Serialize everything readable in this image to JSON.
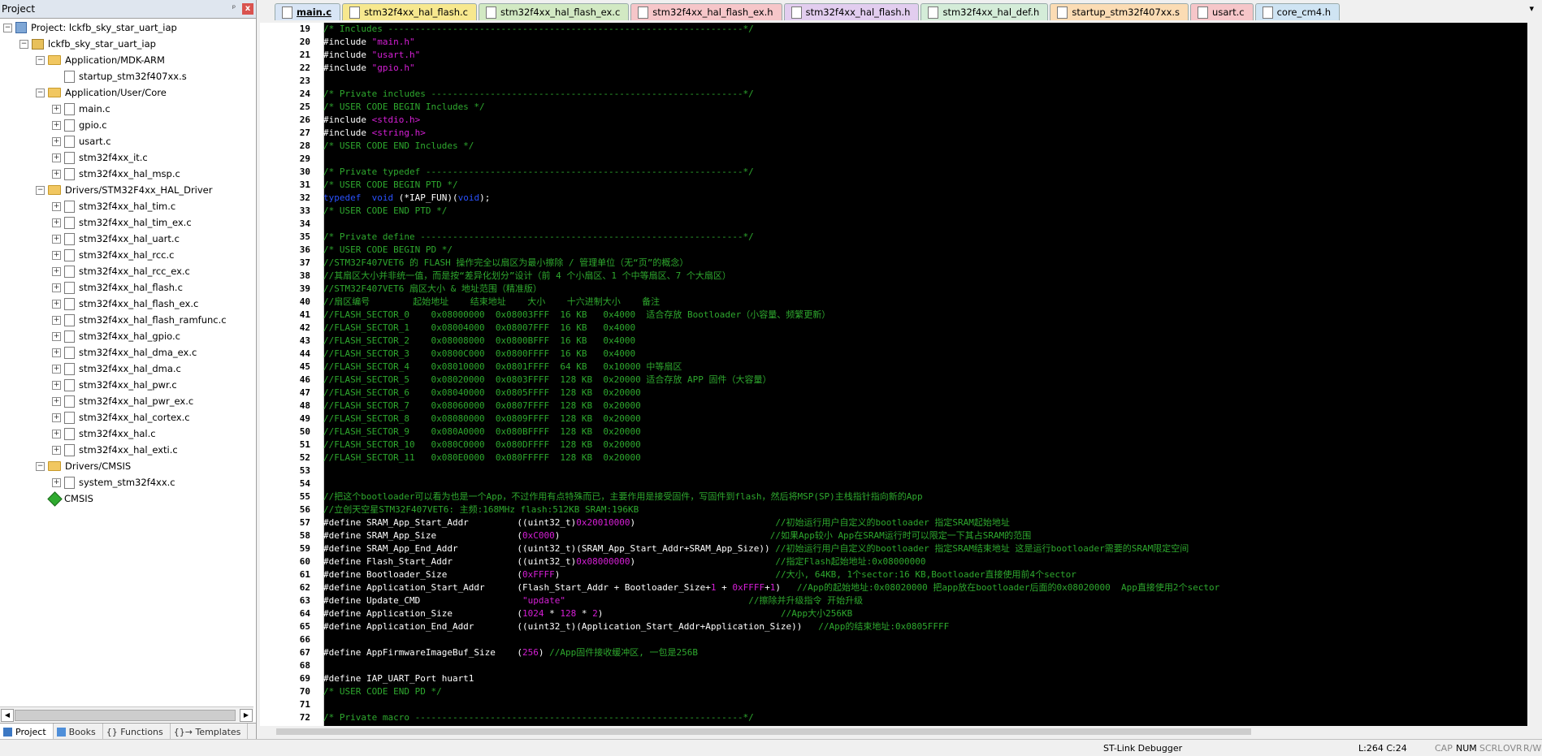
{
  "project_panel": {
    "title": "Project",
    "pin_label": "ᵖ",
    "close_label": "x",
    "tree": [
      {
        "label": "Project: lckfb_sky_star_uart_iap",
        "kind": "proj",
        "depth": 0,
        "exp": "−"
      },
      {
        "label": "lckfb_sky_star_uart_iap",
        "kind": "target",
        "depth": 1,
        "exp": "−"
      },
      {
        "label": "Application/MDK-ARM",
        "kind": "folder",
        "depth": 2,
        "exp": "−"
      },
      {
        "label": "startup_stm32f407xx.s",
        "kind": "file",
        "depth": 3,
        "exp": ""
      },
      {
        "label": "Application/User/Core",
        "kind": "folder",
        "depth": 2,
        "exp": "−"
      },
      {
        "label": "main.c",
        "kind": "file",
        "depth": 3,
        "exp": "+"
      },
      {
        "label": "gpio.c",
        "kind": "file",
        "depth": 3,
        "exp": "+"
      },
      {
        "label": "usart.c",
        "kind": "file",
        "depth": 3,
        "exp": "+"
      },
      {
        "label": "stm32f4xx_it.c",
        "kind": "file",
        "depth": 3,
        "exp": "+"
      },
      {
        "label": "stm32f4xx_hal_msp.c",
        "kind": "file",
        "depth": 3,
        "exp": "+"
      },
      {
        "label": "Drivers/STM32F4xx_HAL_Driver",
        "kind": "folder",
        "depth": 2,
        "exp": "−"
      },
      {
        "label": "stm32f4xx_hal_tim.c",
        "kind": "file",
        "depth": 3,
        "exp": "+"
      },
      {
        "label": "stm32f4xx_hal_tim_ex.c",
        "kind": "file",
        "depth": 3,
        "exp": "+"
      },
      {
        "label": "stm32f4xx_hal_uart.c",
        "kind": "file",
        "depth": 3,
        "exp": "+"
      },
      {
        "label": "stm32f4xx_hal_rcc.c",
        "kind": "file",
        "depth": 3,
        "exp": "+"
      },
      {
        "label": "stm32f4xx_hal_rcc_ex.c",
        "kind": "file",
        "depth": 3,
        "exp": "+"
      },
      {
        "label": "stm32f4xx_hal_flash.c",
        "kind": "file",
        "depth": 3,
        "exp": "+"
      },
      {
        "label": "stm32f4xx_hal_flash_ex.c",
        "kind": "file",
        "depth": 3,
        "exp": "+"
      },
      {
        "label": "stm32f4xx_hal_flash_ramfunc.c",
        "kind": "file",
        "depth": 3,
        "exp": "+"
      },
      {
        "label": "stm32f4xx_hal_gpio.c",
        "kind": "file",
        "depth": 3,
        "exp": "+"
      },
      {
        "label": "stm32f4xx_hal_dma_ex.c",
        "kind": "file",
        "depth": 3,
        "exp": "+"
      },
      {
        "label": "stm32f4xx_hal_dma.c",
        "kind": "file",
        "depth": 3,
        "exp": "+"
      },
      {
        "label": "stm32f4xx_hal_pwr.c",
        "kind": "file",
        "depth": 3,
        "exp": "+"
      },
      {
        "label": "stm32f4xx_hal_pwr_ex.c",
        "kind": "file",
        "depth": 3,
        "exp": "+"
      },
      {
        "label": "stm32f4xx_hal_cortex.c",
        "kind": "file",
        "depth": 3,
        "exp": "+"
      },
      {
        "label": "stm32f4xx_hal.c",
        "kind": "file",
        "depth": 3,
        "exp": "+"
      },
      {
        "label": "stm32f4xx_hal_exti.c",
        "kind": "file",
        "depth": 3,
        "exp": "+"
      },
      {
        "label": "Drivers/CMSIS",
        "kind": "folder",
        "depth": 2,
        "exp": "−"
      },
      {
        "label": "system_stm32f4xx.c",
        "kind": "file",
        "depth": 3,
        "exp": "+"
      },
      {
        "label": "CMSIS",
        "kind": "cmsis",
        "depth": 2,
        "exp": ""
      }
    ],
    "bottom_tabs": [
      {
        "label": "Project",
        "active": true,
        "color": "#3c78c3"
      },
      {
        "label": "Books",
        "active": false,
        "color": "#4f8fd9"
      },
      {
        "label": "{} Functions",
        "active": false,
        "color": ""
      },
      {
        "label": "{}→ Templates",
        "active": false,
        "color": ""
      }
    ]
  },
  "editor_tabs": [
    {
      "label": "main.c",
      "color": "#d8e5f5",
      "active": true
    },
    {
      "label": "stm32f4xx_hal_flash.c",
      "color": "#f7e88e",
      "active": false
    },
    {
      "label": "stm32f4xx_hal_flash_ex.c",
      "color": "#d2e9c3",
      "active": false
    },
    {
      "label": "stm32f4xx_hal_flash_ex.h",
      "color": "#f6c6c9",
      "active": false
    },
    {
      "label": "stm32f4xx_hal_flash.h",
      "color": "#e2cdef",
      "active": false
    },
    {
      "label": "stm32f4xx_hal_def.h",
      "color": "#d4ecd8",
      "active": false
    },
    {
      "label": "startup_stm32f407xx.s",
      "color": "#fbdcb4",
      "active": false
    },
    {
      "label": "usart.c",
      "color": "#f6c6c9",
      "active": false
    },
    {
      "label": "core_cm4.h",
      "color": "#cfe4f3",
      "active": false
    }
  ],
  "tab_dropdown": "▾",
  "colors": {
    "comment": "#2ea82e",
    "string": "#d61fd6",
    "keyword": "#2a52ff"
  },
  "code_lines": [
    {
      "n": "19",
      "segs": [
        [
          "c",
          "/* Includes ------------------------------------------------------------------*/"
        ]
      ]
    },
    {
      "n": "20",
      "segs": [
        [
          "p",
          "#include "
        ],
        [
          "s",
          "\"main.h\""
        ]
      ]
    },
    {
      "n": "21",
      "segs": [
        [
          "p",
          "#include "
        ],
        [
          "s",
          "\"usart.h\""
        ]
      ]
    },
    {
      "n": "22",
      "segs": [
        [
          "p",
          "#include "
        ],
        [
          "s",
          "\"gpio.h\""
        ]
      ]
    },
    {
      "n": "23",
      "segs": []
    },
    {
      "n": "24",
      "segs": [
        [
          "c",
          "/* Private includes ----------------------------------------------------------*/"
        ]
      ]
    },
    {
      "n": "25",
      "segs": [
        [
          "c",
          "/* USER CODE BEGIN Includes */"
        ]
      ]
    },
    {
      "n": "26",
      "segs": [
        [
          "p",
          "#include "
        ],
        [
          "s",
          "<stdio.h>"
        ]
      ]
    },
    {
      "n": "27",
      "segs": [
        [
          "p",
          "#include "
        ],
        [
          "s",
          "<string.h>"
        ]
      ]
    },
    {
      "n": "28",
      "segs": [
        [
          "c",
          "/* USER CODE END Includes */"
        ]
      ]
    },
    {
      "n": "29",
      "segs": []
    },
    {
      "n": "30",
      "segs": [
        [
          "c",
          "/* Private typedef -----------------------------------------------------------*/"
        ]
      ]
    },
    {
      "n": "31",
      "segs": [
        [
          "c",
          "/* USER CODE BEGIN PTD */"
        ]
      ]
    },
    {
      "n": "32",
      "segs": [
        [
          "k",
          "typedef  void "
        ],
        [
          "p",
          "(*IAP_FUN)("
        ],
        [
          "k",
          "void"
        ],
        [
          "p",
          ");"
        ]
      ]
    },
    {
      "n": "33",
      "segs": [
        [
          "c",
          "/* USER CODE END PTD */"
        ]
      ]
    },
    {
      "n": "34",
      "segs": []
    },
    {
      "n": "35",
      "segs": [
        [
          "c",
          "/* Private define ------------------------------------------------------------*/"
        ]
      ]
    },
    {
      "n": "36",
      "segs": [
        [
          "c",
          "/* USER CODE BEGIN PD */"
        ]
      ]
    },
    {
      "n": "37",
      "segs": [
        [
          "c",
          "//STM32F407VET6 的 FLASH 操作完全以扇区为最小擦除 / 管理单位（无“页”的概念）"
        ]
      ]
    },
    {
      "n": "38",
      "segs": [
        [
          "c",
          "//其扇区大小并非统一值，而是按“差异化划分”设计（前 4 个小扇区、1 个中等扇区、7 个大扇区）"
        ]
      ]
    },
    {
      "n": "39",
      "segs": [
        [
          "c",
          "//STM32F407VET6 扇区大小 & 地址范围（精准版）"
        ]
      ]
    },
    {
      "n": "40",
      "segs": [
        [
          "c",
          "//扇区编号        起始地址    结束地址    大小    十六进制大小    备注"
        ]
      ]
    },
    {
      "n": "41",
      "segs": [
        [
          "c",
          "//FLASH_SECTOR_0    0x08000000  0x08003FFF  16 KB   0x4000  适合存放 Bootloader（小容量、频繁更新）"
        ]
      ]
    },
    {
      "n": "42",
      "segs": [
        [
          "c",
          "//FLASH_SECTOR_1    0x08004000  0x08007FFF  16 KB   0x4000"
        ]
      ]
    },
    {
      "n": "43",
      "segs": [
        [
          "c",
          "//FLASH_SECTOR_2    0x08008000  0x0800BFFF  16 KB   0x4000"
        ]
      ]
    },
    {
      "n": "44",
      "segs": [
        [
          "c",
          "//FLASH_SECTOR_3    0x0800C000  0x0800FFFF  16 KB   0x4000"
        ]
      ]
    },
    {
      "n": "45",
      "segs": [
        [
          "c",
          "//FLASH_SECTOR_4    0x08010000  0x0801FFFF  64 KB   0x10000 中等扇区"
        ]
      ]
    },
    {
      "n": "46",
      "segs": [
        [
          "c",
          "//FLASH_SECTOR_5    0x08020000  0x0803FFFF  128 KB  0x20000 适合存放 APP 固件（大容量）"
        ]
      ]
    },
    {
      "n": "47",
      "segs": [
        [
          "c",
          "//FLASH_SECTOR_6    0x08040000  0x0805FFFF  128 KB  0x20000"
        ]
      ]
    },
    {
      "n": "48",
      "segs": [
        [
          "c",
          "//FLASH_SECTOR_7    0x08060000  0x0807FFFF  128 KB  0x20000"
        ]
      ]
    },
    {
      "n": "49",
      "segs": [
        [
          "c",
          "//FLASH_SECTOR_8    0x08080000  0x0809FFFF  128 KB  0x20000"
        ]
      ]
    },
    {
      "n": "50",
      "segs": [
        [
          "c",
          "//FLASH_SECTOR_9    0x080A0000  0x080BFFFF  128 KB  0x20000"
        ]
      ]
    },
    {
      "n": "51",
      "segs": [
        [
          "c",
          "//FLASH_SECTOR_10   0x080C0000  0x080DFFFF  128 KB  0x20000"
        ]
      ]
    },
    {
      "n": "52",
      "segs": [
        [
          "c",
          "//FLASH_SECTOR_11   0x080E0000  0x080FFFFF  128 KB  0x20000"
        ]
      ]
    },
    {
      "n": "53",
      "segs": []
    },
    {
      "n": "54",
      "segs": []
    },
    {
      "n": "55",
      "segs": [
        [
          "c",
          "//把这个bootloader可以看为也是一个App，不过作用有点特殊而已，主要作用是接受固件，写固件到flash，然后将MSP(SP)主栈指针指向新的App"
        ]
      ]
    },
    {
      "n": "56",
      "segs": [
        [
          "c",
          "//立创天空星STM32F407VET6: 主频:168MHz flash:512KB SRAM:196KB"
        ]
      ]
    },
    {
      "n": "57",
      "segs": [
        [
          "p",
          "#define SRAM_App_Start_Addr         ((uint32_t)"
        ],
        [
          "s",
          "0x20010000"
        ],
        [
          "p",
          ")                          "
        ],
        [
          "c",
          "//初始运行用户自定义的bootloader 指定SRAM起始地址"
        ]
      ]
    },
    {
      "n": "58",
      "segs": [
        [
          "p",
          "#define SRAM_App_Size               ("
        ],
        [
          "s",
          "0xC000"
        ],
        [
          "p",
          ")                                       "
        ],
        [
          "c",
          "//如果App较小 App在SRAM运行时可以限定一下其占SRAM的范围"
        ]
      ]
    },
    {
      "n": "59",
      "segs": [
        [
          "p",
          "#define SRAM_App_End_Addr           ((uint32_t)(SRAM_App_Start_Addr+SRAM_App_Size)) "
        ],
        [
          "c",
          "//初始运行用户自定义的bootloader 指定SRAM结束地址 这是运行bootloader需要的SRAM限定空间"
        ]
      ]
    },
    {
      "n": "60",
      "segs": [
        [
          "p",
          "#define Flash_Start_Addr            ((uint32_t)"
        ],
        [
          "s",
          "0x08000000"
        ],
        [
          "p",
          ")                          "
        ],
        [
          "c",
          "//指定Flash起始地址:0x08000000"
        ]
      ]
    },
    {
      "n": "61",
      "segs": [
        [
          "p",
          "#define Bootloader_Size             ("
        ],
        [
          "s",
          "0xFFFF"
        ],
        [
          "p",
          ")                                        "
        ],
        [
          "c",
          "//大小, 64KB, 1个sector:16 KB,Bootloader直接使用前4个sector"
        ]
      ]
    },
    {
      "n": "62",
      "segs": [
        [
          "p",
          "#define Application_Start_Addr      (Flash_Start_Addr + Bootloader_Size+"
        ],
        [
          "s",
          "1"
        ],
        [
          "p",
          " + "
        ],
        [
          "s",
          "0xFFFF"
        ],
        [
          "p",
          "+"
        ],
        [
          "s",
          "1"
        ],
        [
          "p",
          ")   "
        ],
        [
          "c",
          "//App的起始地址:0x08020000 把app放在bootloader后面的0x08020000  App直接使用2个sector"
        ]
      ]
    },
    {
      "n": "63",
      "segs": [
        [
          "p",
          "#define Update_CMD                   "
        ],
        [
          "s",
          "\"update\""
        ],
        [
          "p",
          "                                  "
        ],
        [
          "c",
          "//擦除并升级指令 开始升级"
        ]
      ]
    },
    {
      "n": "64",
      "segs": [
        [
          "p",
          "#define Application_Size            ("
        ],
        [
          "s",
          "1024"
        ],
        [
          "p",
          " * "
        ],
        [
          "s",
          "128"
        ],
        [
          "p",
          " * "
        ],
        [
          "s",
          "2"
        ],
        [
          "p",
          ")                                 "
        ],
        [
          "c",
          "//App大小256KB"
        ]
      ]
    },
    {
      "n": "65",
      "segs": [
        [
          "p",
          "#define Application_End_Addr        ((uint32_t)(Application_Start_Addr+Application_Size))   "
        ],
        [
          "c",
          "//App的结束地址:0x0805FFFF"
        ]
      ]
    },
    {
      "n": "66",
      "segs": []
    },
    {
      "n": "67",
      "segs": [
        [
          "p",
          "#define AppFirmwareImageBuf_Size    ("
        ],
        [
          "s",
          "256"
        ],
        [
          "p",
          ") "
        ],
        [
          "c",
          "//App固件接收缓冲区, 一包是256B"
        ]
      ]
    },
    {
      "n": "68",
      "segs": []
    },
    {
      "n": "69",
      "segs": [
        [
          "p",
          "#define IAP_UART_Port huart1"
        ]
      ]
    },
    {
      "n": "70",
      "segs": [
        [
          "c",
          "/* USER CODE END PD */"
        ]
      ]
    },
    {
      "n": "71",
      "segs": []
    },
    {
      "n": "72",
      "segs": [
        [
          "c",
          "/* Private macro -------------------------------------------------------------*/"
        ]
      ]
    }
  ],
  "status": {
    "debugger": "ST-Link Debugger",
    "position": "L:264 C:24",
    "caps": "CAP",
    "num": "NUM",
    "scrl": "SCRL",
    "ovr": "OVR",
    "rw": "R/W"
  }
}
